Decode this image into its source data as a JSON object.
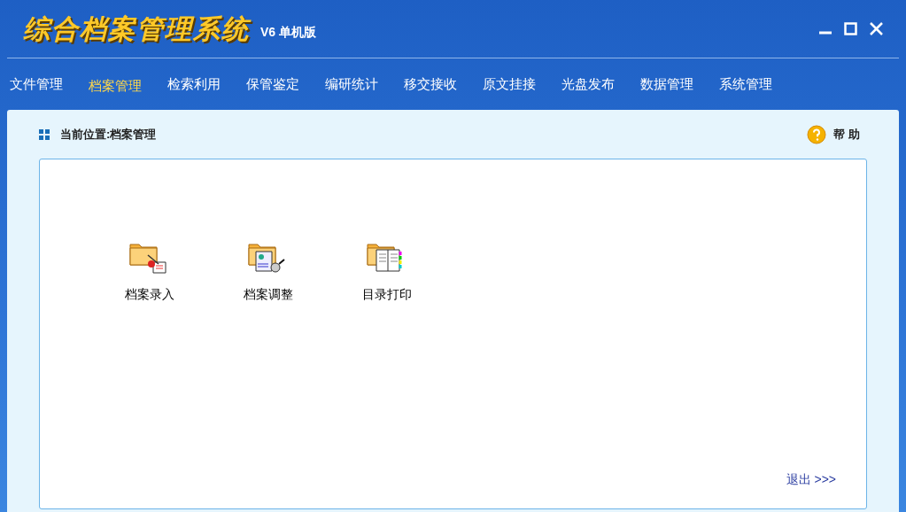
{
  "window": {
    "title": "综合档案管理系统",
    "version": "V6 单机版"
  },
  "nav": [
    {
      "label": "文件管理",
      "selected": false
    },
    {
      "label": "档案管理",
      "selected": true
    },
    {
      "label": "检索利用",
      "selected": false
    },
    {
      "label": "保管鉴定",
      "selected": false
    },
    {
      "label": "编研统计",
      "selected": false
    },
    {
      "label": "移交接收",
      "selected": false
    },
    {
      "label": "原文挂接",
      "selected": false
    },
    {
      "label": "光盘发布",
      "selected": false
    },
    {
      "label": "数据管理",
      "selected": false
    },
    {
      "label": "系统管理",
      "selected": false
    }
  ],
  "breadcrumb": "当前位置:档案管理",
  "help": "帮 助",
  "items": [
    {
      "kind": "entry",
      "label": "档案录入"
    },
    {
      "kind": "adjust",
      "label": "档案调整"
    },
    {
      "kind": "print",
      "label": "目录打印"
    }
  ],
  "exit": "退出 >>>"
}
